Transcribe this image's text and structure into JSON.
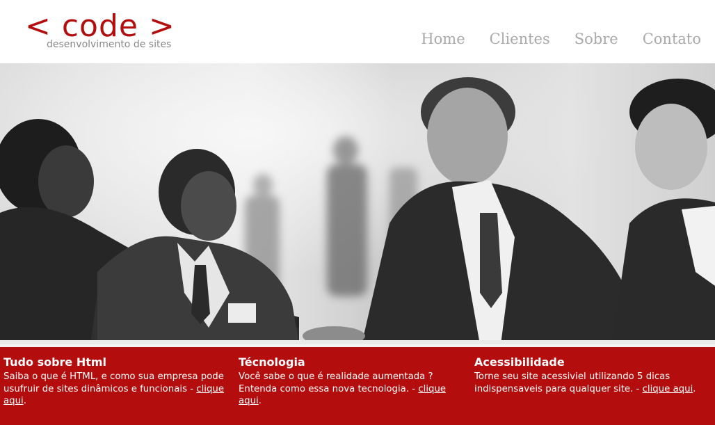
{
  "brand": {
    "logo_text": "< code >",
    "tagline": "desenvolvimento de sites",
    "accent_color": "#b40d0d"
  },
  "nav": {
    "items": [
      {
        "label": "Home"
      },
      {
        "label": "Clientes"
      },
      {
        "label": "Sobre"
      },
      {
        "label": "Contato"
      }
    ]
  },
  "hero": {
    "image_subject": "business-handshake-photo"
  },
  "features": [
    {
      "title": "Tudo sobre Html",
      "text": "Saiba o que é HTML, e como sua empresa pode usufruir de sites dinâmicos e funcionais - ",
      "link": "clique aqui",
      "end": "."
    },
    {
      "title": "Técnologia",
      "text": "Você sabe o que é realidade aumentada ? Entenda como essa nova tecnologia. - ",
      "link": "clique aqui",
      "end": "."
    },
    {
      "title": "Acessibilidade",
      "text": "Torne seu site acessiviel utilizando 5 dicas indispensaveis para qualquer site. - ",
      "link": "clique aqui",
      "end": "."
    }
  ]
}
